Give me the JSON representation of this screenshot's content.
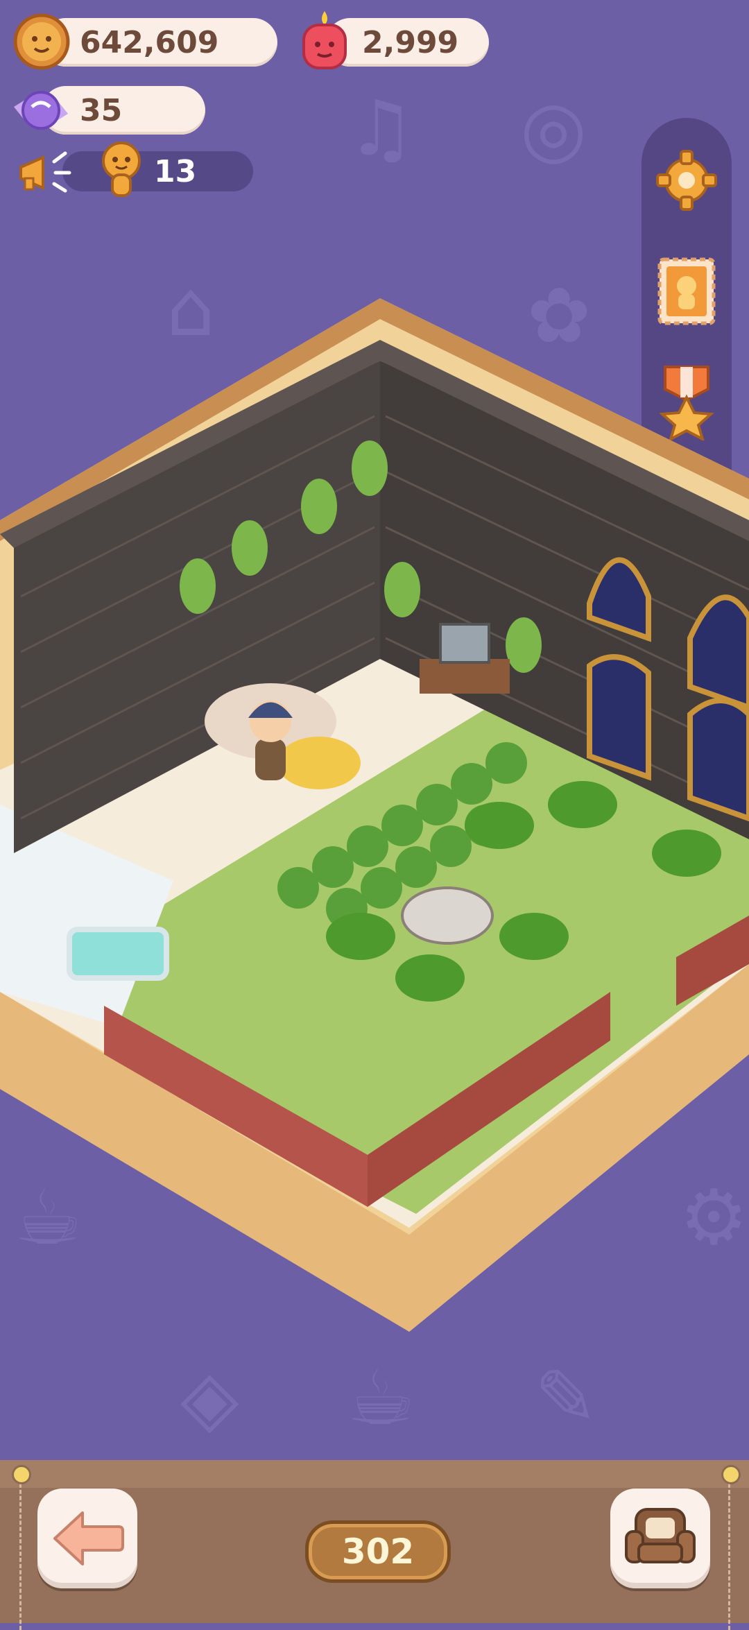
{
  "hud": {
    "coins": "642,609",
    "gems": "2,999",
    "candies": "35",
    "visitors": "13"
  },
  "side_menu": {
    "items": [
      "settings-icon",
      "stamp-icon",
      "medal-icon",
      "bag-icon"
    ]
  },
  "footer": {
    "room_count": "302"
  },
  "icons": {
    "back": "left-arrow-icon",
    "furniture": "armchair-icon"
  },
  "colors": {
    "background": "#6c5fa6",
    "pill": "#fbeee6",
    "pill_text": "#6e4a3a",
    "bottom_bar": "#95705a",
    "badge": "#b27a3e"
  }
}
